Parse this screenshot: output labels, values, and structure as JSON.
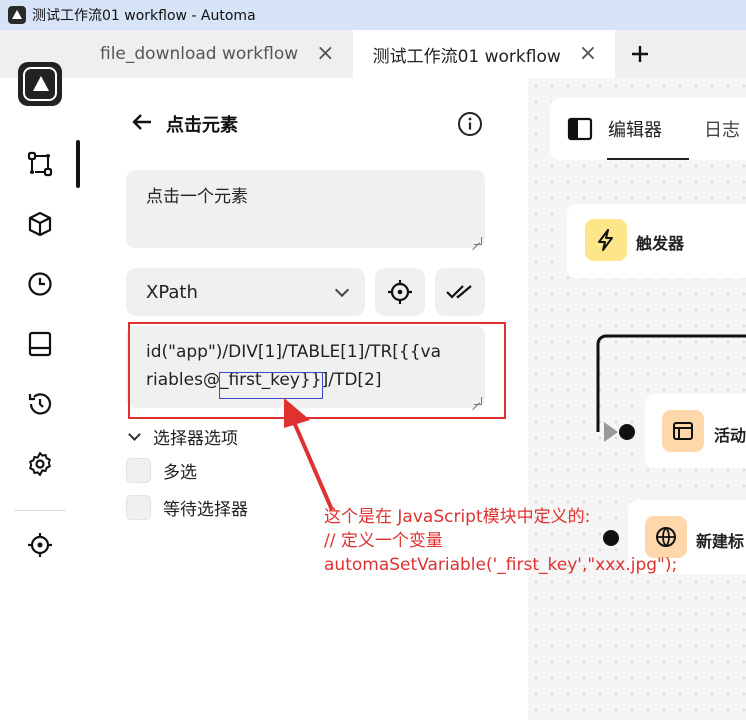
{
  "window": {
    "title": "测试工作流01 workflow - Automa"
  },
  "tabs": [
    {
      "label": "file_download workflow",
      "active": false
    },
    {
      "label": "测试工作流01 workflow",
      "active": true
    }
  ],
  "nav": {
    "icons": [
      "workflow-icon",
      "package-icon",
      "clock-icon",
      "storage-icon",
      "history-icon",
      "settings-icon",
      "crosshair-icon"
    ]
  },
  "panel": {
    "block_title": "点击元素",
    "description": "点击一个元素",
    "selector_type": "XPath",
    "selector_line1": "id(\"app\")/DIV[1]/TABLE[1]/TR[{{va",
    "selector_line2": "riables@_first_key}}]/TD[2]",
    "options_label": "选择器选项",
    "multiple_label": "多选",
    "wait_label": "等待选择器"
  },
  "annotation": {
    "line1": "这个是在 JavaScript模块中定义的:",
    "line2": "// 定义一个变量",
    "line3": "automaSetVariable('_first_key',\"xxx.jpg\");"
  },
  "canvas": {
    "tab_editor": "编辑器",
    "tab_log": "日志",
    "node_trigger": "触发器",
    "node_active_tab": "活动",
    "node_new_tab": "新建标"
  },
  "colors": {
    "annotation_red": "#e03131",
    "highlight_blue": "#3b4bc8",
    "trigger_yellow": "#fde68a",
    "node_orange": "#fed7aa"
  }
}
